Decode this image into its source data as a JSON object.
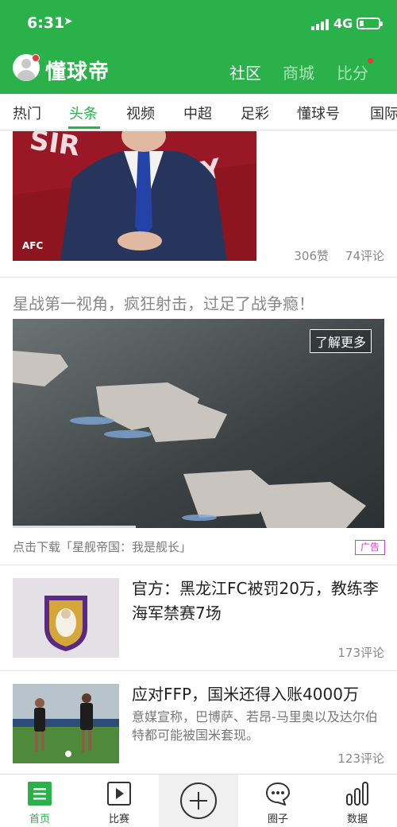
{
  "status_bar": {
    "time": "6:31",
    "network": "4G"
  },
  "app": {
    "brand": "懂球帝"
  },
  "top_nav": [
    {
      "label": "社区",
      "active": true
    },
    {
      "label": "商城",
      "active": false
    },
    {
      "label": "比分",
      "active": false,
      "has_dot": true
    }
  ],
  "channels": [
    "热门",
    "头条",
    "视频",
    "中超",
    "足彩",
    "懂球号",
    "国际"
  ],
  "active_channel": "头条",
  "feed": {
    "item1": {
      "likes": "306赞",
      "comments": "74评论"
    },
    "ad": {
      "title": "星战第一视角，疯狂射击，过足了战争瘾！",
      "cta": "了解更多",
      "caption": "点击下载「星舰帝国：我是舰长」",
      "badge": "广告"
    },
    "item2": {
      "headline": "官方：黑龙江FC被罚20万，教练李海军禁赛7场",
      "comments": "173评论"
    },
    "item3": {
      "headline": "应对FFP，国米还得入账4000万",
      "summary": "意媒宣称，巴博萨、若昂-马里奥以及达尔伯特都可能被国米套现。",
      "comments": "123评论"
    }
  },
  "tabbar": [
    {
      "label": "首页",
      "icon": "home-list-icon",
      "active": true
    },
    {
      "label": "比赛",
      "icon": "play-video-icon",
      "active": false
    },
    {
      "label": "",
      "icon": "plus-circle-icon",
      "active": false
    },
    {
      "label": "圈子",
      "icon": "chat-bubble-icon",
      "active": false
    },
    {
      "label": "数据",
      "icon": "bar-chart-icon",
      "active": false
    }
  ],
  "colors": {
    "brand_green": "#2ab14a",
    "ad_badge": "#d23bd6",
    "notify_red": "#e83a3a"
  }
}
